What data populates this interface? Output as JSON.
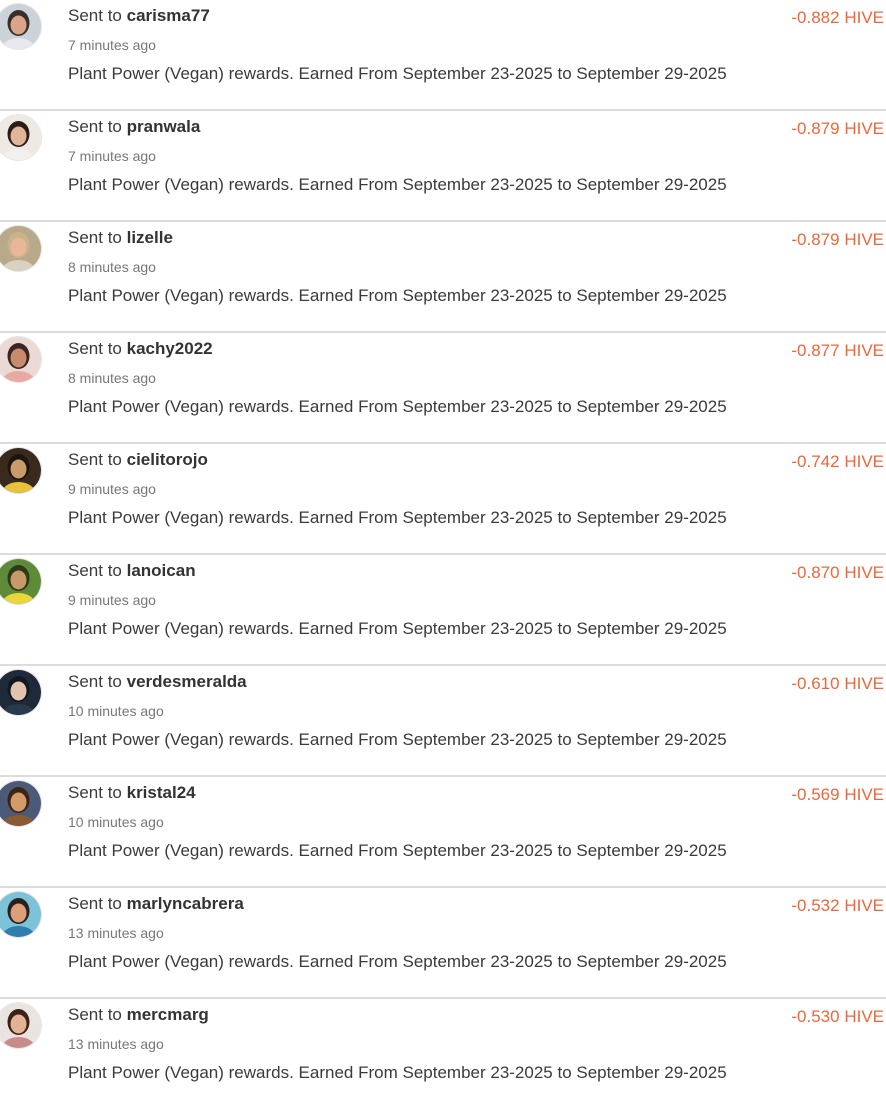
{
  "transfers": [
    {
      "sent_prefix": "Sent to",
      "username": "carisma77",
      "time_ago": "7 minutes ago",
      "memo": "Plant Power (Vegan) rewards. Earned From September 23-2025 to September 29-2025",
      "amount": "-0.882 HIVE",
      "avatar": {
        "bg": "#c9d3d8",
        "skin": "#d8a48a",
        "hair": "#3a2e2a",
        "clothes": "#e8e8ee"
      }
    },
    {
      "sent_prefix": "Sent to",
      "username": "pranwala",
      "time_ago": "7 minutes ago",
      "memo": "Plant Power (Vegan) rewards. Earned From September 23-2025 to September 29-2025",
      "amount": "-0.879 HIVE",
      "avatar": {
        "bg": "#efe9e4",
        "skin": "#e0b59a",
        "hair": "#2a1d18",
        "clothes": "#f2f0ee"
      }
    },
    {
      "sent_prefix": "Sent to",
      "username": "lizelle",
      "time_ago": "8 minutes ago",
      "memo": "Plant Power (Vegan) rewards. Earned From September 23-2025 to September 29-2025",
      "amount": "-0.879 HIVE",
      "avatar": {
        "bg": "#b9a98a",
        "skin": "#e8b698",
        "hair": "#c9b48a",
        "clothes": "#d9d2c0"
      }
    },
    {
      "sent_prefix": "Sent to",
      "username": "kachy2022",
      "time_ago": "8 minutes ago",
      "memo": "Plant Power (Vegan) rewards. Earned From September 23-2025 to September 29-2025",
      "amount": "-0.877 HIVE",
      "avatar": {
        "bg": "#ead9d4",
        "skin": "#c98b6e",
        "hair": "#3a2620",
        "clothes": "#e7a9a0"
      }
    },
    {
      "sent_prefix": "Sent to",
      "username": "cielitorojo",
      "time_ago": "9 minutes ago",
      "memo": "Plant Power (Vegan) rewards. Earned From September 23-2025 to September 29-2025",
      "amount": "-0.742 HIVE",
      "avatar": {
        "bg": "#3a2a1e",
        "skin": "#c99a6a",
        "hair": "#1e1510",
        "clothes": "#e8c23a"
      }
    },
    {
      "sent_prefix": "Sent to",
      "username": "lanoican",
      "time_ago": "9 minutes ago",
      "memo": "Plant Power (Vegan) rewards. Earned From September 23-2025 to September 29-2025",
      "amount": "-0.870 HIVE",
      "avatar": {
        "bg": "#5f8a3a",
        "skin": "#c89a6a",
        "hair": "#2d3a1a",
        "clothes": "#e9d63a"
      }
    },
    {
      "sent_prefix": "Sent to",
      "username": "verdesmeralda",
      "time_ago": "10 minutes ago",
      "memo": "Plant Power (Vegan) rewards. Earned From September 23-2025 to September 29-2025",
      "amount": "-0.610 HIVE",
      "avatar": {
        "bg": "#1e2a3a",
        "skin": "#e2c4ae",
        "hair": "#101820",
        "clothes": "#2a3a4e"
      }
    },
    {
      "sent_prefix": "Sent to",
      "username": "kristal24",
      "time_ago": "10 minutes ago",
      "memo": "Plant Power (Vegan) rewards. Earned From September 23-2025 to September 29-2025",
      "amount": "-0.569 HIVE",
      "avatar": {
        "bg": "#4a5a78",
        "skin": "#d39a6a",
        "hair": "#3a2414",
        "clothes": "#8a5a32"
      }
    },
    {
      "sent_prefix": "Sent to",
      "username": "marlyncabrera",
      "time_ago": "13 minutes ago",
      "memo": "Plant Power (Vegan) rewards. Earned From September 23-2025 to September 29-2025",
      "amount": "-0.532 HIVE",
      "avatar": {
        "bg": "#7cc2d8",
        "skin": "#d9a07a",
        "hair": "#2a1f1a",
        "clothes": "#2f7fae"
      }
    },
    {
      "sent_prefix": "Sent to",
      "username": "mercmarg",
      "time_ago": "13 minutes ago",
      "memo": "Plant Power (Vegan) rewards. Earned From September 23-2025 to September 29-2025",
      "amount": "-0.530 HIVE",
      "avatar": {
        "bg": "#eae4e0",
        "skin": "#e3b294",
        "hair": "#3a2218",
        "clothes": "#c98a8a"
      }
    }
  ]
}
